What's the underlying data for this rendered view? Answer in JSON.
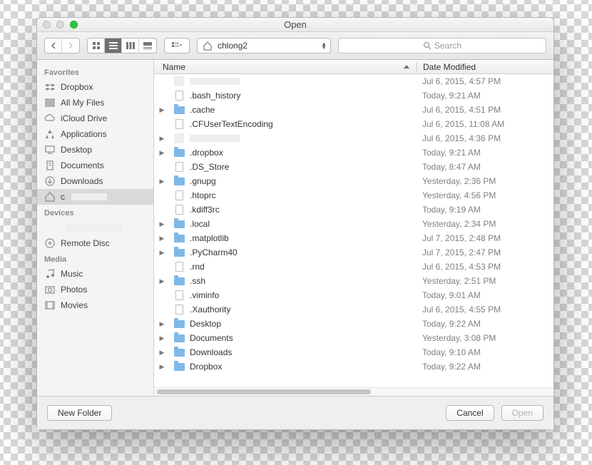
{
  "title": "Open",
  "toolbar": {
    "location": "chlong2",
    "search_placeholder": "Search"
  },
  "sidebar": {
    "favorites_label": "Favorites",
    "devices_label": "Devices",
    "media_label": "Media",
    "favorites": [
      {
        "icon": "dropbox",
        "label": "Dropbox"
      },
      {
        "icon": "allfiles",
        "label": "All My Files"
      },
      {
        "icon": "icloud",
        "label": "iCloud Drive"
      },
      {
        "icon": "apps",
        "label": "Applications"
      },
      {
        "icon": "desktop",
        "label": "Desktop"
      },
      {
        "icon": "docs",
        "label": "Documents"
      },
      {
        "icon": "downloads",
        "label": "Downloads"
      },
      {
        "icon": "home",
        "label": "c"
      }
    ],
    "devices": [
      {
        "icon": "blank",
        "label": ""
      },
      {
        "icon": "disc",
        "label": "Remote Disc"
      }
    ],
    "media": [
      {
        "icon": "music",
        "label": "Music"
      },
      {
        "icon": "photos",
        "label": "Photos"
      },
      {
        "icon": "movies",
        "label": "Movies"
      }
    ]
  },
  "columns": {
    "name": "Name",
    "date": "Date Modified"
  },
  "files": [
    {
      "expand": false,
      "type": "redact",
      "name": "",
      "date": "Jul 6, 2015, 4:57 PM"
    },
    {
      "expand": false,
      "type": "file",
      "name": ".bash_history",
      "date": "Today, 9:21 AM"
    },
    {
      "expand": true,
      "type": "folder",
      "name": ".cache",
      "date": "Jul 6, 2015, 4:51 PM"
    },
    {
      "expand": false,
      "type": "file",
      "name": ".CFUserTextEncoding",
      "date": "Jul 6, 2015, 11:08 AM"
    },
    {
      "expand": true,
      "type": "redact",
      "name": "",
      "date": "Jul 6, 2015, 4:36 PM"
    },
    {
      "expand": true,
      "type": "folder",
      "name": ".dropbox",
      "date": "Today, 9:21 AM"
    },
    {
      "expand": false,
      "type": "file",
      "name": ".DS_Store",
      "date": "Today, 8:47 AM"
    },
    {
      "expand": true,
      "type": "folder",
      "name": ".gnupg",
      "date": "Yesterday, 2:36 PM"
    },
    {
      "expand": false,
      "type": "file",
      "name": ".htoprc",
      "date": "Yesterday, 4:56 PM"
    },
    {
      "expand": false,
      "type": "file",
      "name": ".kdiff3rc",
      "date": "Today, 9:19 AM"
    },
    {
      "expand": true,
      "type": "folder",
      "name": ".local",
      "date": "Yesterday, 2:34 PM"
    },
    {
      "expand": true,
      "type": "folder",
      "name": ".matplotlib",
      "date": "Jul 7, 2015, 2:48 PM"
    },
    {
      "expand": true,
      "type": "folder",
      "name": ".PyCharm40",
      "date": "Jul 7, 2015, 2:47 PM"
    },
    {
      "expand": false,
      "type": "file",
      "name": ".rnd",
      "date": "Jul 6, 2015, 4:53 PM"
    },
    {
      "expand": true,
      "type": "folder",
      "name": ".ssh",
      "date": "Yesterday, 2:51 PM"
    },
    {
      "expand": false,
      "type": "file",
      "name": ".viminfo",
      "date": "Today, 9:01 AM"
    },
    {
      "expand": false,
      "type": "file",
      "name": ".Xauthority",
      "date": "Jul 6, 2015, 4:55 PM"
    },
    {
      "expand": true,
      "type": "folder",
      "name": "Desktop",
      "date": "Today, 9:22 AM"
    },
    {
      "expand": true,
      "type": "folder",
      "name": "Documents",
      "date": "Yesterday, 3:08 PM"
    },
    {
      "expand": true,
      "type": "folder",
      "name": "Downloads",
      "date": "Today, 9:10 AM"
    },
    {
      "expand": true,
      "type": "folder",
      "name": "Dropbox",
      "date": "Today, 9:22 AM"
    }
  ],
  "footer": {
    "new_folder": "New Folder",
    "cancel": "Cancel",
    "open": "Open"
  }
}
